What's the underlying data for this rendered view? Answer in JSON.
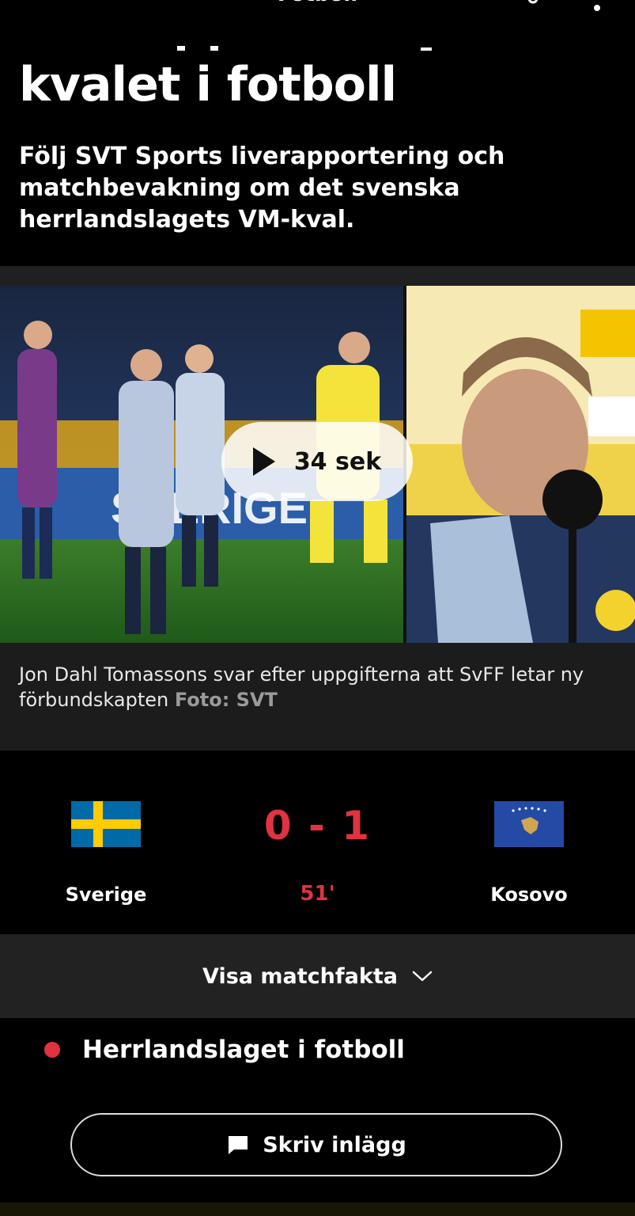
{
  "appbar": {
    "title": "Fotboll",
    "back_icon": "arrow-left-icon",
    "share_icon": "share-icon",
    "more_icon": "more-vertical-icon"
  },
  "article": {
    "headline": "kvalet i fotboll",
    "lede": "Följ SVT Sports liverapportering och matchbevakning om det svenska herrlandslagets VM-kval."
  },
  "media": {
    "duration": "34 sek",
    "caption": "Jon Dahl Tomassons svar efter uppgifterna att SvFF letar ny förbundskapten",
    "credit": "Foto: SVT"
  },
  "match": {
    "home": {
      "name": "Sverige",
      "flag_colors": [
        "#006aa7",
        "#fecc00"
      ]
    },
    "away": {
      "name": "Kosovo",
      "flag_colors": [
        "#244aa5",
        "#d0a650"
      ]
    },
    "score": "0 - 1",
    "minute": "51'",
    "score_color": "#e0333f"
  },
  "matchfakta": {
    "label": "Visa matchfakta"
  },
  "live": {
    "label": "Herrlandslaget i fotboll",
    "dot_color": "#e0333f"
  },
  "compose": {
    "label": "Skriv inlägg",
    "icon": "chat-bubble-icon"
  }
}
